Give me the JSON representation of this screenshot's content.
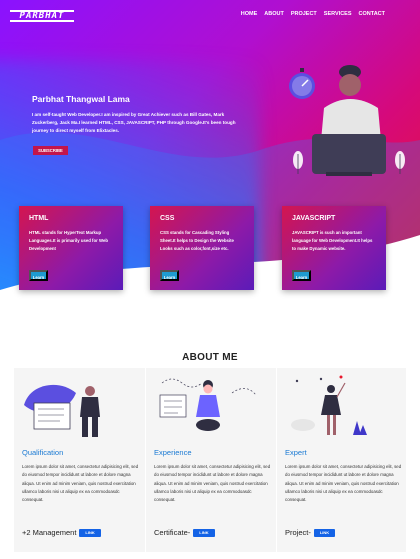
{
  "header": {
    "logo_text": "PARBHAT",
    "nav": [
      "HOME",
      "ABOUT",
      "PROJECT",
      "SERVICES",
      "CONTACT"
    ]
  },
  "hero": {
    "name": "Parbhat Thangwal Lama",
    "description": "I am self-taught Web Developer.I am inspired by Great Achiever such as Bill Gates, Mark Zuckerberg, Jack Ma.I learned HTML, CSS, JAVASCRIPT, PHP through Google.It's been tough journey to direct myself from Elixtacles.",
    "subscribe_label": "SUBSCRIBE"
  },
  "skills": [
    {
      "title": "HTML",
      "text": "HTML stands for HyperText Markup Languages.It is primarily used for Web Development",
      "button": "Learn"
    },
    {
      "title": "CSS",
      "text": "CSS stands for Cascading Styling Sheet.It helps to Design the Website Looks such as color,font,size etc.",
      "button": "Learn"
    },
    {
      "title": "JAVASCRIPT",
      "text": "JAVASCRIPT is such an important language for Web Development.It helps to make Dynamic website.",
      "button": "Learn"
    }
  ],
  "about": {
    "title": "ABOUT ME",
    "columns": [
      {
        "heading": "Qualification",
        "text": "Lorem ipsum dolor sit amet, consectetur adipisicing elit, sed do eiusmod tempor incididunt ut labore et dolore magna aliqua. Ut enim ad minim veniam, quis nostrud exercitation ullamco laboris nisi ut aliquip ex ea commodoasdc consequat.",
        "footer": "+2 Management",
        "button": "LINK"
      },
      {
        "heading": "Experience",
        "text": "Lorem ipsum dolor sit amet, consectetur adipisicing elit, sed do eiusmod tempor incididunt ut labore et dolore magna aliqua. Ut enim ad minim veniam, quis nostrud exercitation ullamco laboris nisi ut aliquip ex ea commodoasdc consequat.",
        "footer": "Certificate-",
        "button": "LINK"
      },
      {
        "heading": "Expert",
        "text": "Lorem ipsum dolor sit amet, consectetur adipisicing elit, sed do eiusmod tempor incididunt ut labore et dolore magna aliqua. Ut enim ad minim veniam, quis nostrud exercitation ullamco laboris nisi ut aliquip ex ea commodoasdc consequat.",
        "footer": "Project-",
        "button": "LINK"
      }
    ]
  },
  "colors": {
    "hero_gradient_start": "#8a12ff",
    "hero_gradient_end": "#e8172c",
    "accent_blue": "#1463e6",
    "heading_blue": "#1b7ad3",
    "subscribe": "#c4154a",
    "learn_button": "#1e9bd0"
  },
  "icons": [
    "laptop-developer-illustration",
    "plant-icon",
    "stopwatch-icon"
  ]
}
